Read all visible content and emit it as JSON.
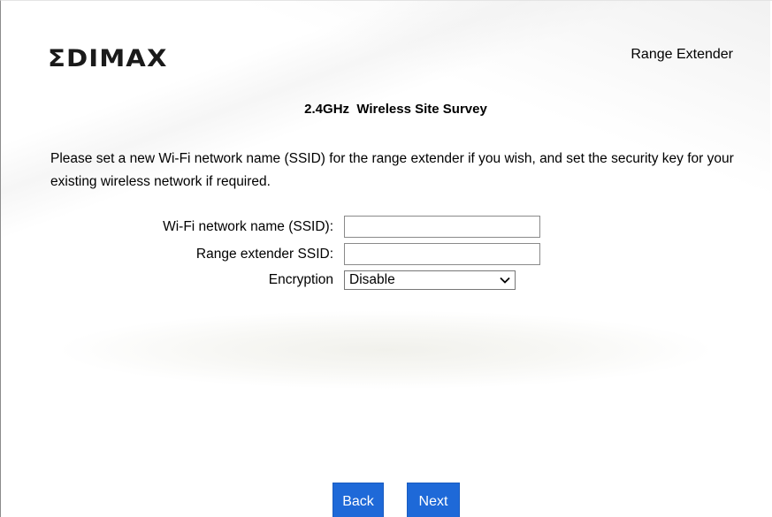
{
  "header": {
    "logo_text": "ƩDIMAX",
    "product_name": "Range Extender"
  },
  "main": {
    "title": "2.4GHz  Wireless Site Survey",
    "instructions": "Please set a new Wi-Fi network name (SSID) for the range extender if you wish, and set the security key for your existing wireless network if required."
  },
  "form": {
    "ssid_label": "Wi-Fi network name (SSID):",
    "ssid_value": "",
    "extender_ssid_label": "Range extender SSID:",
    "extender_ssid_value": "",
    "encryption_label": "Encryption",
    "encryption_selected": "Disable"
  },
  "buttons": {
    "back_label": "Back",
    "next_label": "Next"
  },
  "colors": {
    "button_blue": "#1e69d8"
  },
  "icons": {
    "select_arrow": "chevron-down-icon"
  }
}
